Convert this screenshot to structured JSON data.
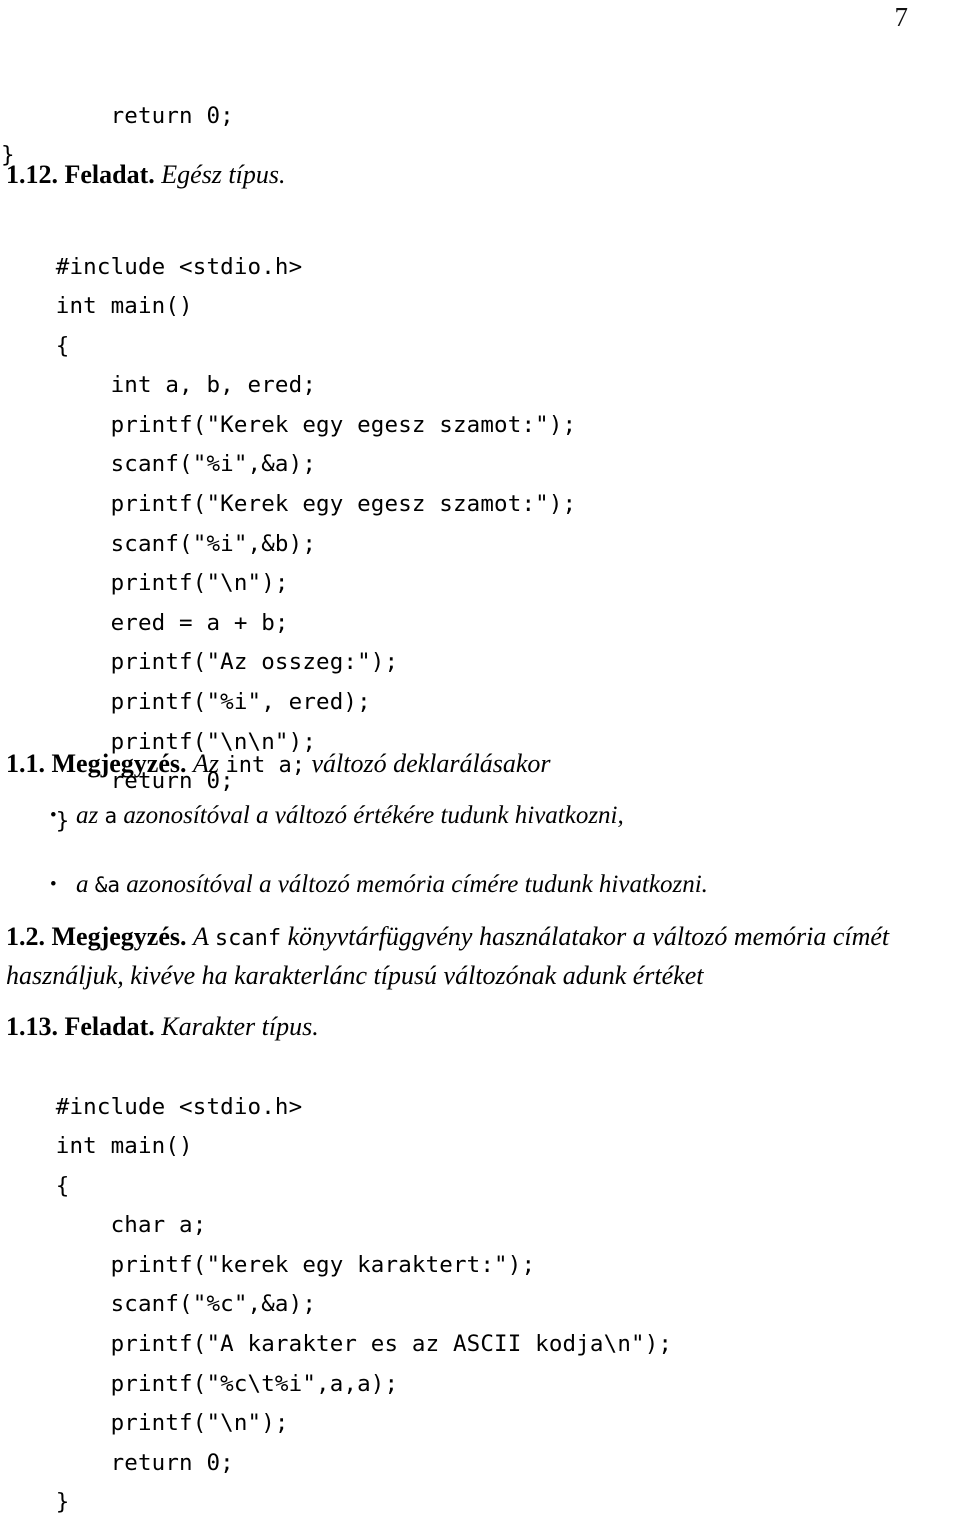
{
  "page": {
    "number": "7"
  },
  "code_top": {
    "lines": [
      "        return 0;",
      "}"
    ]
  },
  "exercise_112": {
    "number": "1.12.",
    "kind": "Feladat.",
    "title": "Egész típus."
  },
  "code_block_1": {
    "lines": [
      "    #include <stdio.h>",
      "    int main()",
      "    {",
      "        int a, b, ered;",
      "        printf(\"Kerek egy egesz szamot:\");",
      "        scanf(\"%i\",&a);",
      "        printf(\"Kerek egy egesz szamot:\");",
      "        scanf(\"%i\",&b);",
      "        printf(\"\\n\");",
      "        ered = a + b;",
      "        printf(\"Az osszeg:\");",
      "        printf(\"%i\", ered);",
      "        printf(\"\\n\\n\");",
      "        return 0;",
      "    }"
    ]
  },
  "remark_11": {
    "number": "1.1.",
    "kind": "Megjegyzés.",
    "lead_italic": "Az ",
    "lead_mono": "int a;",
    "lead_tail": " változó deklarálásakor",
    "bullets": [
      {
        "marker": "•",
        "pre": "az ",
        "mono": "a",
        "post": " azonosítóval a változó értékére tudunk hivatkozni,"
      },
      {
        "marker": "•",
        "pre": "a ",
        "mono": "&a",
        "post": " azonosítóval a változó memória címére tudunk hivatkozni."
      }
    ]
  },
  "remark_12": {
    "number": "1.2.",
    "kind": "Megjegyzés.",
    "lead_italic": "A ",
    "lead_mono": "scanf",
    "body": " könyvtárfüggvény használatakor a változó memória címét használjuk, kivéve ha karakterlánc típusú változónak adunk értéket"
  },
  "exercise_113": {
    "number": "1.13.",
    "kind": "Feladat.",
    "title": "Karakter típus."
  },
  "code_block_2": {
    "lines": [
      "    #include <stdio.h>",
      "    int main()",
      "    {",
      "        char a;",
      "        printf(\"kerek egy karaktert:\");",
      "        scanf(\"%c\",&a);",
      "        printf(\"A karakter es az ASCII kodja\\n\");",
      "        printf(\"%c\\t%i\",a,a);",
      "        printf(\"\\n\");",
      "        return 0;",
      "    }"
    ]
  }
}
